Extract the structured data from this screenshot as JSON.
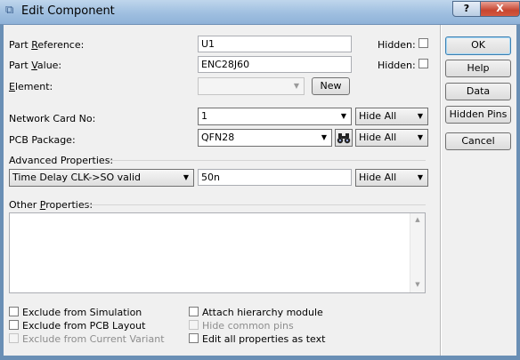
{
  "window": {
    "title": "Edit Component",
    "help_glyph": "?",
    "close_glyph": "X"
  },
  "fields": {
    "part_reference": {
      "label_pre": "Part ",
      "label_ul": "R",
      "label_post": "eference:",
      "value": "U1",
      "hidden_label": "Hidden:"
    },
    "part_value": {
      "label_pre": "Part ",
      "label_ul": "V",
      "label_post": "alue:",
      "value": "ENC28J60",
      "hidden_label": "Hidden:"
    },
    "element": {
      "label_ul": "E",
      "label_post": "lement:",
      "value": "",
      "new_button": "New"
    },
    "network_card": {
      "label": "Network Card No:",
      "value": "1",
      "visibility": "Hide All"
    },
    "pcb_package": {
      "label": "PCB Package:",
      "value": "QFN28",
      "visibility": "Hide All"
    },
    "advanced": {
      "label": "Advanced Properties:",
      "property": "Time Delay CLK->SO valid",
      "value": "50n",
      "visibility": "Hide All"
    },
    "other": {
      "label_pre": "Other ",
      "label_ul": "P",
      "label_post": "roperties:",
      "value": ""
    }
  },
  "buttons": {
    "ok": "OK",
    "help": "Help",
    "data": "Data",
    "hidden_pins": "Hidden Pins",
    "cancel": "Cancel"
  },
  "options": {
    "exclude_simulation": "Exclude from Simulation",
    "exclude_pcb": "Exclude from PCB Layout",
    "exclude_variant": "Exclude from Current Variant",
    "attach_hierarchy": "Attach hierarchy module",
    "hide_common_pins": "Hide common pins",
    "edit_all_text": "Edit all properties as text"
  }
}
